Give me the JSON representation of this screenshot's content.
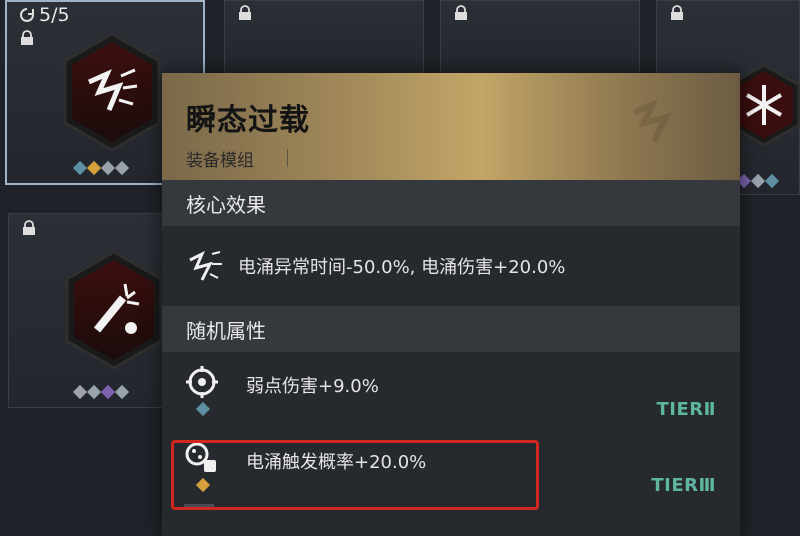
{
  "grid": {
    "counter": "5/5",
    "slots": [
      {
        "state": "selected",
        "pips": [
          "blue",
          "gold",
          "grey",
          "grey"
        ]
      },
      {
        "state": "locked"
      },
      {
        "state": "locked"
      },
      {
        "state": "locked",
        "pips": [
          "purple",
          "grey",
          "blue"
        ]
      },
      {
        "state": "locked",
        "pips": [
          "grey",
          "grey",
          "purple",
          "grey"
        ]
      }
    ]
  },
  "tooltip": {
    "title": "瞬态过载",
    "subtitle": "装备模组",
    "core": {
      "header": "核心效果",
      "effect": "电涌异常时间-50.0%, 电涌伤害+20.0%"
    },
    "random": {
      "header": "随机属性",
      "attrs": [
        {
          "text": "弱点伤害+9.0%",
          "tier": "TIERⅡ",
          "pip_color": "#5e8fa3",
          "icon": "crosshair-icon"
        },
        {
          "text": "电涌触发概率+20.0%",
          "tier": "TIERⅢ",
          "pip_color": "#d6a13b",
          "icon": "dice-icon"
        }
      ]
    }
  },
  "colors": {
    "accent_gold": "#c2a567",
    "tier_green": "#5fb6a0",
    "highlight_red": "#d3271f"
  }
}
